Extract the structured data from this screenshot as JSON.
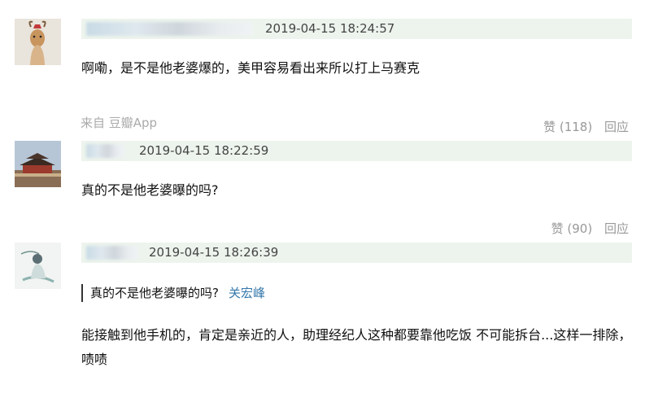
{
  "comments": [
    {
      "time": "2019-04-15 18:24:57",
      "text": "啊嘞，是不是他老婆爆的，美甲容易看出来所以打上马赛克",
      "source": "来自 豆瓣App",
      "like": "赞 (118)",
      "reply": "回应"
    },
    {
      "time": "2019-04-15 18:22:59",
      "text": "真的不是他老婆曝的吗?",
      "like": "赞 (90)",
      "reply": "回应"
    },
    {
      "time": "2019-04-15 18:26:39",
      "quote_text": "真的不是他老婆曝的吗?",
      "quote_author": "关宏峰",
      "text": "能接触到他手机的，肯定是亲近的人，助理经纪人这种都要靠他吃饭 不可能拆台...这样一排除，啧啧"
    }
  ],
  "colors": {
    "meta_bg": "#edf4ed",
    "link": "#3377aa",
    "muted": "#999999"
  }
}
